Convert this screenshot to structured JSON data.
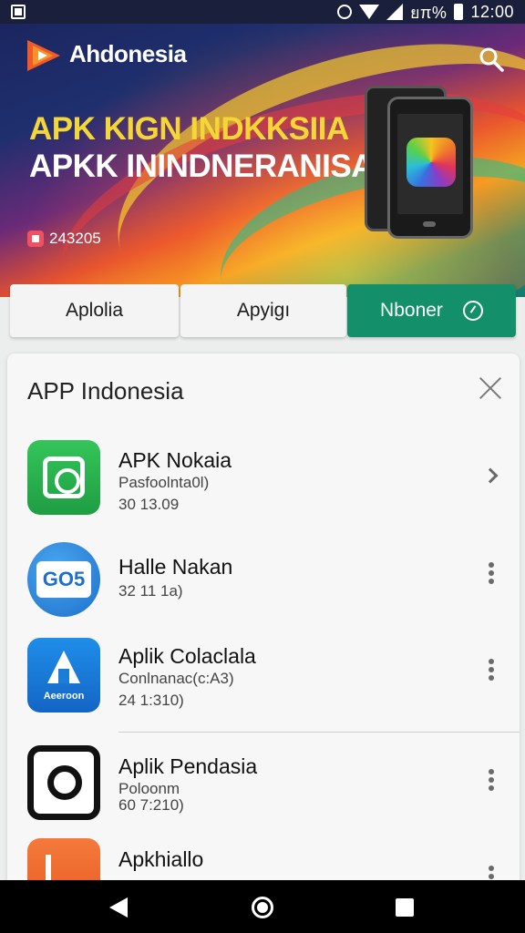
{
  "status_bar": {
    "battery_text": "ยπ%",
    "time": "12:00"
  },
  "header": {
    "app_title": "Ahdonesia",
    "headline_1": "APK KIGN INDKKSIIA",
    "headline_2": "APKK ININDNERANISA",
    "badge_text": "243205"
  },
  "tabs": [
    {
      "label": "Aplolia"
    },
    {
      "label": "Apyigı"
    },
    {
      "label": "Nboner"
    }
  ],
  "card": {
    "title": "APP Indonesia",
    "apps": [
      {
        "name": "APK Nokaia",
        "line1": "Pasfoolnta0l)",
        "line2": "30 13.09",
        "icon": "camera-frame-icon",
        "action": "chevron-right-icon"
      },
      {
        "name": "Halle Nakan",
        "line1": "",
        "line2": "32 11 1a)",
        "icon": "go5-icon",
        "icon_text": "GO5",
        "action": "more-vert-icon"
      },
      {
        "name": "Aplik Colaclala",
        "line1": "Conlnanac(c:A3)",
        "line2": "24 1:310)",
        "icon": "a-logo-icon",
        "icon_label": "Aeeroon",
        "action": "more-vert-icon"
      },
      {
        "name": "Aplik Pendasia",
        "line1": "Poloonm",
        "line2": "60 7:210)",
        "icon": "ring-icon",
        "action": "more-vert-icon"
      },
      {
        "name": "Apkhiallo",
        "line1": "",
        "line2": "",
        "icon": "orange-k-icon",
        "action": "more-vert-icon"
      }
    ]
  },
  "colors": {
    "accent_green": "#13906a",
    "status_bar_bg": "#1a1f3c",
    "headline_yellow": "#f4d637"
  }
}
